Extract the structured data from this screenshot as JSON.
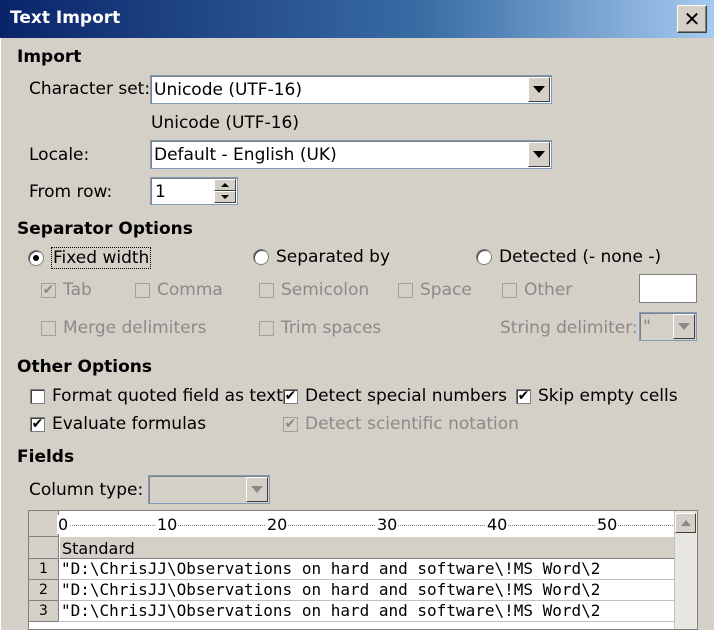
{
  "window": {
    "title": "Text Import",
    "close_glyph": "✕"
  },
  "import": {
    "heading": "Import",
    "charset_label": "Character set:",
    "charset_value": "Unicode (UTF-16)",
    "charset_info": "Unicode (UTF-16)",
    "locale_label": "Locale:",
    "locale_value": "Default - English (UK)",
    "from_row_label": "From row:",
    "from_row_value": "1"
  },
  "separator": {
    "heading": "Separator Options",
    "fixed_width": {
      "label": "Fixed width",
      "selected": true
    },
    "separated_by": {
      "label": "Separated by",
      "selected": false
    },
    "detected": {
      "label": "Detected (- none -)",
      "selected": false
    },
    "tab": {
      "label": "Tab",
      "checked": true,
      "enabled": false
    },
    "comma": {
      "label": "Comma",
      "checked": false,
      "enabled": false
    },
    "semicolon": {
      "label": "Semicolon",
      "checked": false,
      "enabled": false
    },
    "space": {
      "label": "Space",
      "checked": false,
      "enabled": false
    },
    "other": {
      "label": "Other",
      "checked": false,
      "enabled": false,
      "value": ""
    },
    "merge_delimiters": {
      "label": "Merge delimiters",
      "checked": false,
      "enabled": false
    },
    "trim_spaces": {
      "label": "Trim spaces",
      "checked": false,
      "enabled": false
    },
    "string_delimiter_label": "String delimiter:",
    "string_delimiter_value": "\""
  },
  "other_options": {
    "heading": "Other Options",
    "format_quoted": {
      "label": "Format quoted field as text",
      "checked": false
    },
    "detect_special": {
      "label": "Detect special numbers",
      "checked": true
    },
    "skip_empty": {
      "label": "Skip empty cells",
      "checked": true
    },
    "evaluate_formulas": {
      "label": "Evaluate formulas",
      "checked": true
    },
    "detect_scientific": {
      "label": "Detect scientific notation",
      "checked": true,
      "enabled": false
    }
  },
  "fields": {
    "heading": "Fields",
    "column_type_label": "Column type:",
    "column_type_value": "",
    "ruler_ticks": [
      "0",
      "10",
      "20",
      "30",
      "40",
      "50"
    ],
    "column_header": "Standard",
    "rows": [
      {
        "num": "1",
        "text": "\"D:\\ChrisJJ\\Observations on hard and software\\!MS Word\\2"
      },
      {
        "num": "2",
        "text": "\"D:\\ChrisJJ\\Observations on hard and software\\!MS Word\\2"
      },
      {
        "num": "3",
        "text": "\"D:\\ChrisJJ\\Observations on hard and software\\!MS Word\\2"
      }
    ]
  }
}
